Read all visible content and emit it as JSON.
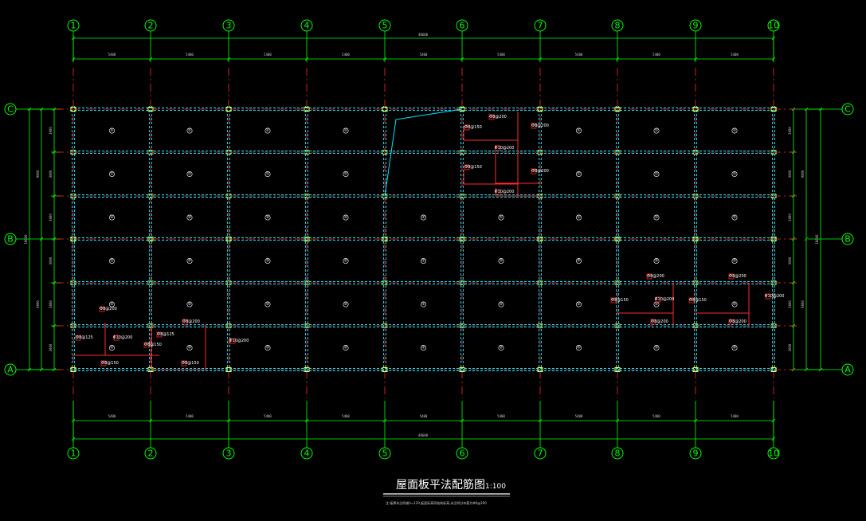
{
  "drawing": {
    "title": "屋面板平法配筋图",
    "scale": "1:100",
    "note": "注:板厚未注明者h=120,板面标高同结构标高,未注明分布筋为Φ6@200",
    "colors": {
      "background": "#000000",
      "axis": "#00ff00",
      "beam": "#00e5ff",
      "rebar": "#ff2a2a",
      "text": "#ffffff"
    }
  },
  "axes": {
    "vertical": [
      "1",
      "2",
      "3",
      "4",
      "5",
      "6",
      "7",
      "8",
      "9",
      "10"
    ],
    "horizontal": [
      "C",
      "B",
      "A"
    ]
  },
  "dimensions": {
    "top_bays": [
      "5400",
      "5400",
      "5400",
      "5400",
      "5400",
      "5400",
      "5400",
      "5400",
      "5400"
    ],
    "bottom_bays": [
      "5400",
      "5400",
      "5400",
      "5400",
      "5400",
      "5400",
      "5400",
      "5400",
      "5400"
    ],
    "top_total": "48600",
    "bottom_total": "48600",
    "left_bays": [
      "3000",
      "3000",
      "3000",
      "3000",
      "3000",
      "3000"
    ],
    "left_subtotals": [
      "9000",
      "9000"
    ],
    "left_total": "18000",
    "right_bays": [
      "3000",
      "3000",
      "3000",
      "3000",
      "3000",
      "3000"
    ],
    "right_subtotals": [
      "9000",
      "9000"
    ],
    "right_total": "18000"
  },
  "slab_marks": {
    "row1": [
      "①",
      "①",
      "①",
      "①",
      "",
      "①",
      "①",
      "①"
    ],
    "row2": [
      "①",
      "①",
      "①",
      "①",
      "",
      "①",
      "①",
      "①"
    ],
    "row3": [
      "②",
      "②",
      "②",
      "②",
      "②",
      "①",
      "①",
      "①",
      "①"
    ],
    "row4": [
      "②",
      "②",
      "②",
      "②",
      "②",
      "②",
      "②",
      "②",
      "②"
    ],
    "row5": [
      "②",
      "②",
      "②",
      "②",
      "②",
      "②",
      "②",
      "②",
      "②"
    ],
    "row6": [
      "②",
      "②",
      "②",
      "②",
      "②",
      "②",
      "②",
      "②",
      "②"
    ]
  },
  "rebar_labels": {
    "a": "Φ8@200",
    "b": "Φ8@150",
    "c": "Φ10@200",
    "d": "Φ8@125"
  }
}
